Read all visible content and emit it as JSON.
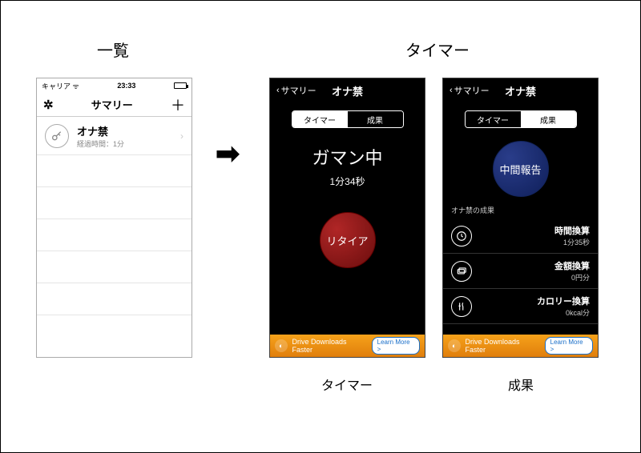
{
  "headings": {
    "list": "一覧",
    "timer": "タイマー"
  },
  "sublabels": {
    "timer": "タイマー",
    "results": "成果"
  },
  "light": {
    "carrier": "キャリア",
    "time": "23:33",
    "nav_title": "サマリー",
    "row": {
      "title": "オナ禁",
      "sub": "経過時間：1分"
    }
  },
  "dark_shared": {
    "back_label": "サマリー",
    "nav_title": "オナ禁",
    "tab_timer": "タイマー",
    "tab_results": "成果",
    "ad_text": "Drive Downloads Faster",
    "ad_cta": "Learn More >"
  },
  "timer_screen": {
    "status_title": "ガマン中",
    "status_sub": "1分34秒",
    "retire": "リタイア"
  },
  "results_screen": {
    "report": "中間報告",
    "section_label": "オナ禁の成果",
    "rows": [
      {
        "title": "時間換算",
        "value": "1分35秒"
      },
      {
        "title": "金額換算",
        "value": "0円分"
      },
      {
        "title": "カロリー換算",
        "value": "0kcal分"
      }
    ]
  }
}
